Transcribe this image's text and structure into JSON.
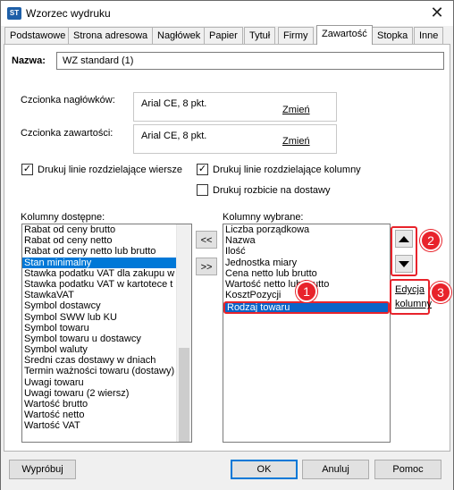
{
  "window": {
    "title": "Wzorzec wydruku",
    "close_symbol": "✕",
    "icon_text": "ST"
  },
  "tabs": [
    {
      "label": "Podstawowe"
    },
    {
      "label": "Strona adresowa"
    },
    {
      "label": "Nagłówek"
    },
    {
      "label": "Papier"
    },
    {
      "label": "Tytuł"
    },
    {
      "label": "Firmy"
    },
    {
      "label": "Zawartość",
      "active": true
    },
    {
      "label": "Stopka"
    },
    {
      "label": "Inne"
    }
  ],
  "name_field": {
    "label": "Nazwa:",
    "value": "WZ standard (1)"
  },
  "header_font": {
    "label": "Czcionka nagłówków:",
    "value": "Arial CE, 8 pkt.",
    "change_label": "Zmień"
  },
  "content_font": {
    "label": "Czcionka zawartości:",
    "value": "Arial CE, 8 pkt.",
    "change_label": "Zmień"
  },
  "checkboxes": {
    "row_lines": {
      "label": "Drukuj linie rozdzielające wiersze",
      "checked": true
    },
    "column_lines": {
      "label": "Drukuj linie rozdzielające kolumny",
      "checked": true
    },
    "delivery_split": {
      "label": "Drukuj rozbicie na dostawy",
      "checked": false
    },
    "check_mark": "✓"
  },
  "available": {
    "label": "Kolumny dostępne:",
    "items": [
      "Rabat od ceny brutto",
      "Rabat od ceny netto",
      "Rabat od ceny netto lub brutto",
      "Stan minimalny",
      "Stawka podatku VAT dla zakupu w",
      "Stawka podatku VAT w kartotece t",
      "StawkaVAT",
      "Symbol dostawcy",
      "Symbol SWW lub KU",
      "Symbol towaru",
      "Symbol towaru u dostawcy",
      "Symbol waluty",
      "Średni czas dostawy w dniach",
      "Termin ważności towaru (dostawy)",
      "Uwagi towaru",
      "Uwagi towaru (2 wiersz)",
      "Wartość brutto",
      "Wartość netto",
      "Wartość VAT"
    ],
    "selected_index": 3
  },
  "move_buttons": {
    "add": "<<",
    "remove": ">>"
  },
  "chosen": {
    "label": "Kolumny wybrane:",
    "items": [
      "Liczba porządkowa",
      "Nazwa",
      "Ilość",
      "Jednostka miary",
      "Cena netto lub brutto",
      "Wartość netto lub brutto",
      "KosztPozycji",
      "Rodzaj towaru"
    ],
    "selected_index": 7
  },
  "order_buttons": {
    "up_icon": "arrow-up",
    "down_icon": "arrow-down"
  },
  "edit_columns": {
    "line1": "Edycja",
    "line2": "kolumny"
  },
  "badges": [
    "1",
    "2",
    "3"
  ],
  "footer": {
    "preview": "Wypróbuj",
    "ok": "OK",
    "cancel": "Anuluj",
    "help": "Pomoc"
  },
  "colors": {
    "highlight_red": "#e8232b",
    "selection_blue": "#0078d7"
  }
}
